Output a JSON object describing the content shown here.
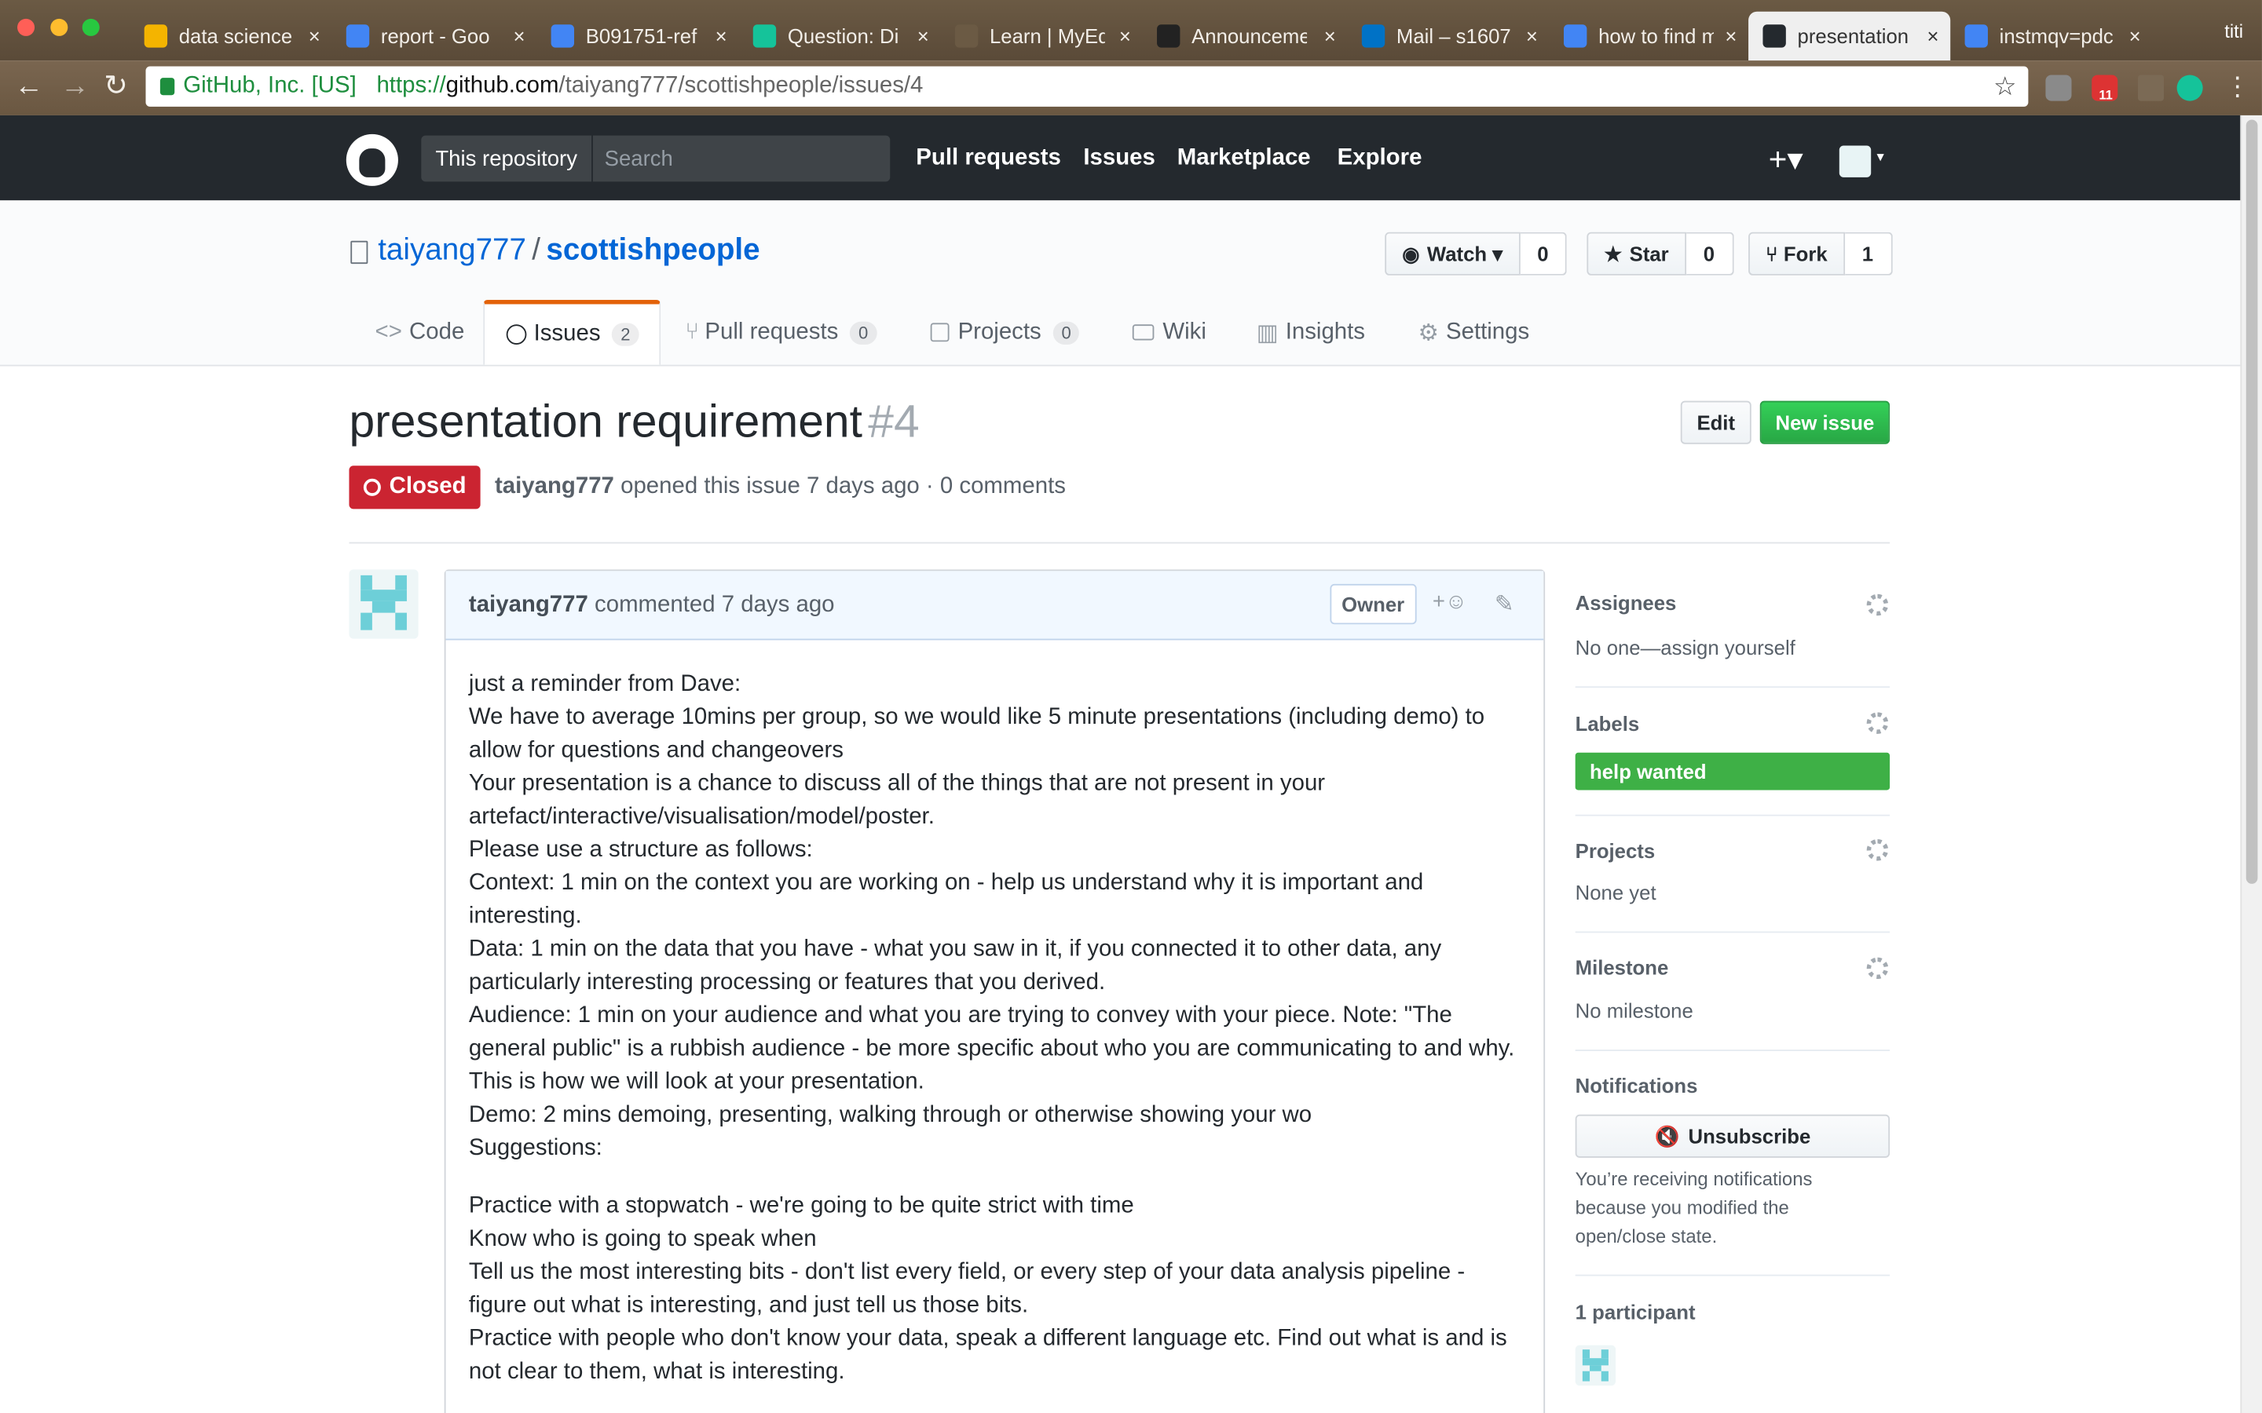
{
  "browser": {
    "tabs": [
      {
        "title": "data science",
        "favicon_color": "#f4b400"
      },
      {
        "title": "report - Goo",
        "favicon_color": "#4285f4"
      },
      {
        "title": "B091751-ref",
        "favicon_color": "#4285f4"
      },
      {
        "title": "Question: Di",
        "favicon_color": "#15c39a"
      },
      {
        "title": "Learn | MyEd",
        "favicon_color": "#6b5a44"
      },
      {
        "title": "Announceme",
        "favicon_color": "#222222"
      },
      {
        "title": "Mail – s1607",
        "favicon_color": "#0072c6"
      },
      {
        "title": "how to find m",
        "favicon_color": "#4285f4"
      },
      {
        "title": "presentation",
        "favicon_color": "#24292e",
        "active": true
      },
      {
        "title": "instmqv=pdc",
        "favicon_color": "#4285f4"
      }
    ],
    "profile_label": "titi",
    "secure_label": "GitHub, Inc. [US]",
    "url_scheme": "https://",
    "url_host": "github.com",
    "url_path": "/taiyang777/scottishpeople/issues/4",
    "extension_badge": "11",
    "icons": [
      "back-icon",
      "forward-icon",
      "reload-icon",
      "star-icon",
      "menu-icon"
    ]
  },
  "header": {
    "scope_label": "This repository",
    "search_placeholder": "Search",
    "nav": [
      "Pull requests",
      "Issues",
      "Marketplace",
      "Explore"
    ],
    "plus_label": "+▾"
  },
  "repo": {
    "owner": "taiyang777",
    "separator": "/",
    "name": "scottishpeople",
    "watch": {
      "label": "Watch ▾",
      "count": "0"
    },
    "star": {
      "label": "Star",
      "count": "0"
    },
    "fork": {
      "label": "Fork",
      "count": "1"
    },
    "tabs": [
      {
        "label": "Code",
        "count": ""
      },
      {
        "label": "Issues",
        "count": "2",
        "selected": true
      },
      {
        "label": "Pull requests",
        "count": "0"
      },
      {
        "label": "Projects",
        "count": "0"
      },
      {
        "label": "Wiki",
        "count": ""
      },
      {
        "label": "Insights",
        "count": ""
      },
      {
        "label": "Settings",
        "count": ""
      }
    ]
  },
  "issue": {
    "title": "presentation requirement",
    "number": "#4",
    "edit_label": "Edit",
    "new_issue_label": "New issue",
    "state": "Closed",
    "author": "taiyang777",
    "meta_rest": "opened this issue 7 days ago · 0 comments",
    "comment": {
      "author": "taiyang777",
      "action": "commented 7 days ago",
      "role": "Owner",
      "react_label": "+☺",
      "lines_block1": [
        "just a reminder from Dave:",
        "We have to average 10mins per group, so we would like 5 minute presentations (including demo) to allow for questions and changeovers",
        "Your presentation is a chance to discuss all of the things that are not present in your artefact/interactive/visualisation/model/poster.",
        "Please use a structure as follows:",
        "Context: 1 min on the context you are working on - help us understand why it is important and interesting.",
        "Data: 1 min on the data that you have - what you saw in it, if you connected it to other data, any particularly interesting processing or features that you derived.",
        "Audience: 1 min on your audience and what you are trying to convey with your piece. Note: \"The general public\" is a rubbish audience - be more specific about who you are communicating to and why. This is how we will look at your presentation.",
        "Demo: 2 mins demoing, presenting, walking through or otherwise showing your wo",
        "Suggestions:"
      ],
      "lines_block2": [
        "Practice with a stopwatch - we're going to be quite strict with time",
        "Know who is going to speak when",
        "Tell us the most interesting bits - don't list every field, or every step of your data analysis pipeline - figure out what is interesting, and just tell us those bits.",
        "Practice with people who don't know your data, speak a different language etc. Find out what is and is not clear to them, what is interesting."
      ]
    }
  },
  "sidebar": {
    "assignees": {
      "heading": "Assignees",
      "value": "No one—assign yourself"
    },
    "labels": {
      "heading": "Labels",
      "label": "help wanted",
      "label_color": "#3eb046"
    },
    "projects": {
      "heading": "Projects",
      "value": "None yet"
    },
    "milestone": {
      "heading": "Milestone",
      "value": "No milestone"
    },
    "notifications": {
      "heading": "Notifications",
      "button": "Unsubscribe",
      "text": "You’re receiving notifications because you modified the open/close state."
    },
    "participants": {
      "heading": "1 participant"
    }
  }
}
